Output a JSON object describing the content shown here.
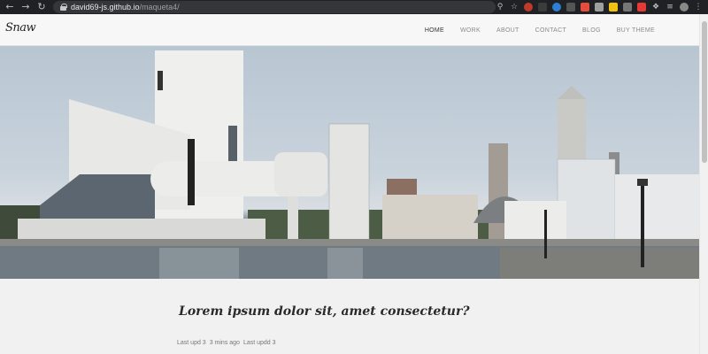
{
  "browser": {
    "url_host": "david69-js.github.io",
    "url_path": "/maqueta4/",
    "back_icon": "back-arrow-icon",
    "forward_icon": "forward-arrow-icon",
    "reload_icon": "reload-icon"
  },
  "site": {
    "logo": "Snaw",
    "menu": [
      {
        "label": "HOME"
      },
      {
        "label": "WORK"
      },
      {
        "label": "ABOUT"
      },
      {
        "label": "CONTACT"
      },
      {
        "label": "BLOG"
      },
      {
        "label": "BUY THEME"
      }
    ]
  },
  "article": {
    "title": "Lorem ipsum dolor sit, amet consectetur?",
    "meta_1": "Last upd 3",
    "meta_2": "3 mins ago",
    "meta_3": "Last updd 3"
  },
  "colors": {
    "chrome_bg": "#202124",
    "header_bg": "#f7f7f7",
    "page_bg": "#f1f1f1",
    "title_text": "#2a2a2a"
  }
}
